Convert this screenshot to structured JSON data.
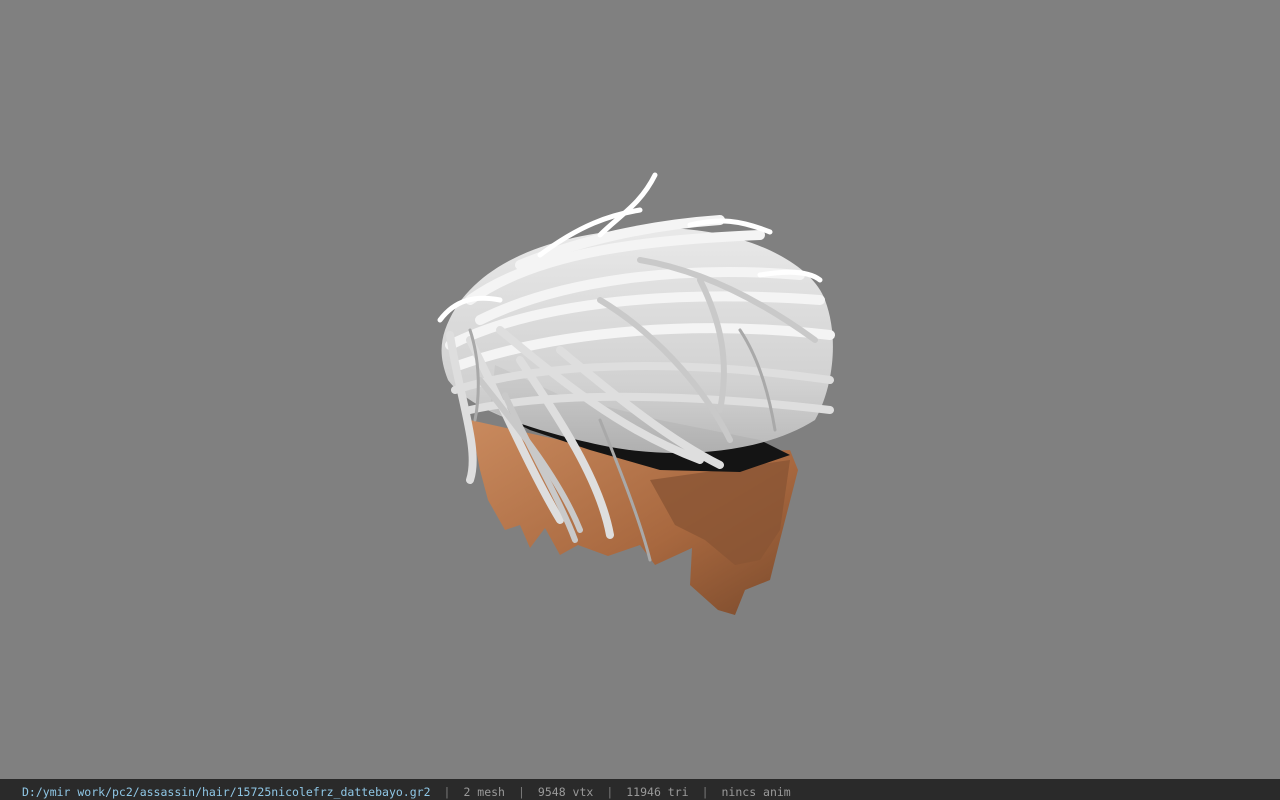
{
  "viewer": {
    "background_color": "#808080",
    "model": {
      "name_icon": "hair-model-icon",
      "hair_color": "#e6e6e6",
      "skin_color": "#b0734c"
    }
  },
  "status": {
    "file_path": "D:/ymir work/pc2/assassin/hair/15725nicolefrz_dattebayo.gr2",
    "separator": "|",
    "mesh": "2 mesh",
    "vertices": "9548 vtx",
    "triangles": "11946 tri",
    "anim": "nincs anim",
    "path_color": "#8fc7e6"
  }
}
